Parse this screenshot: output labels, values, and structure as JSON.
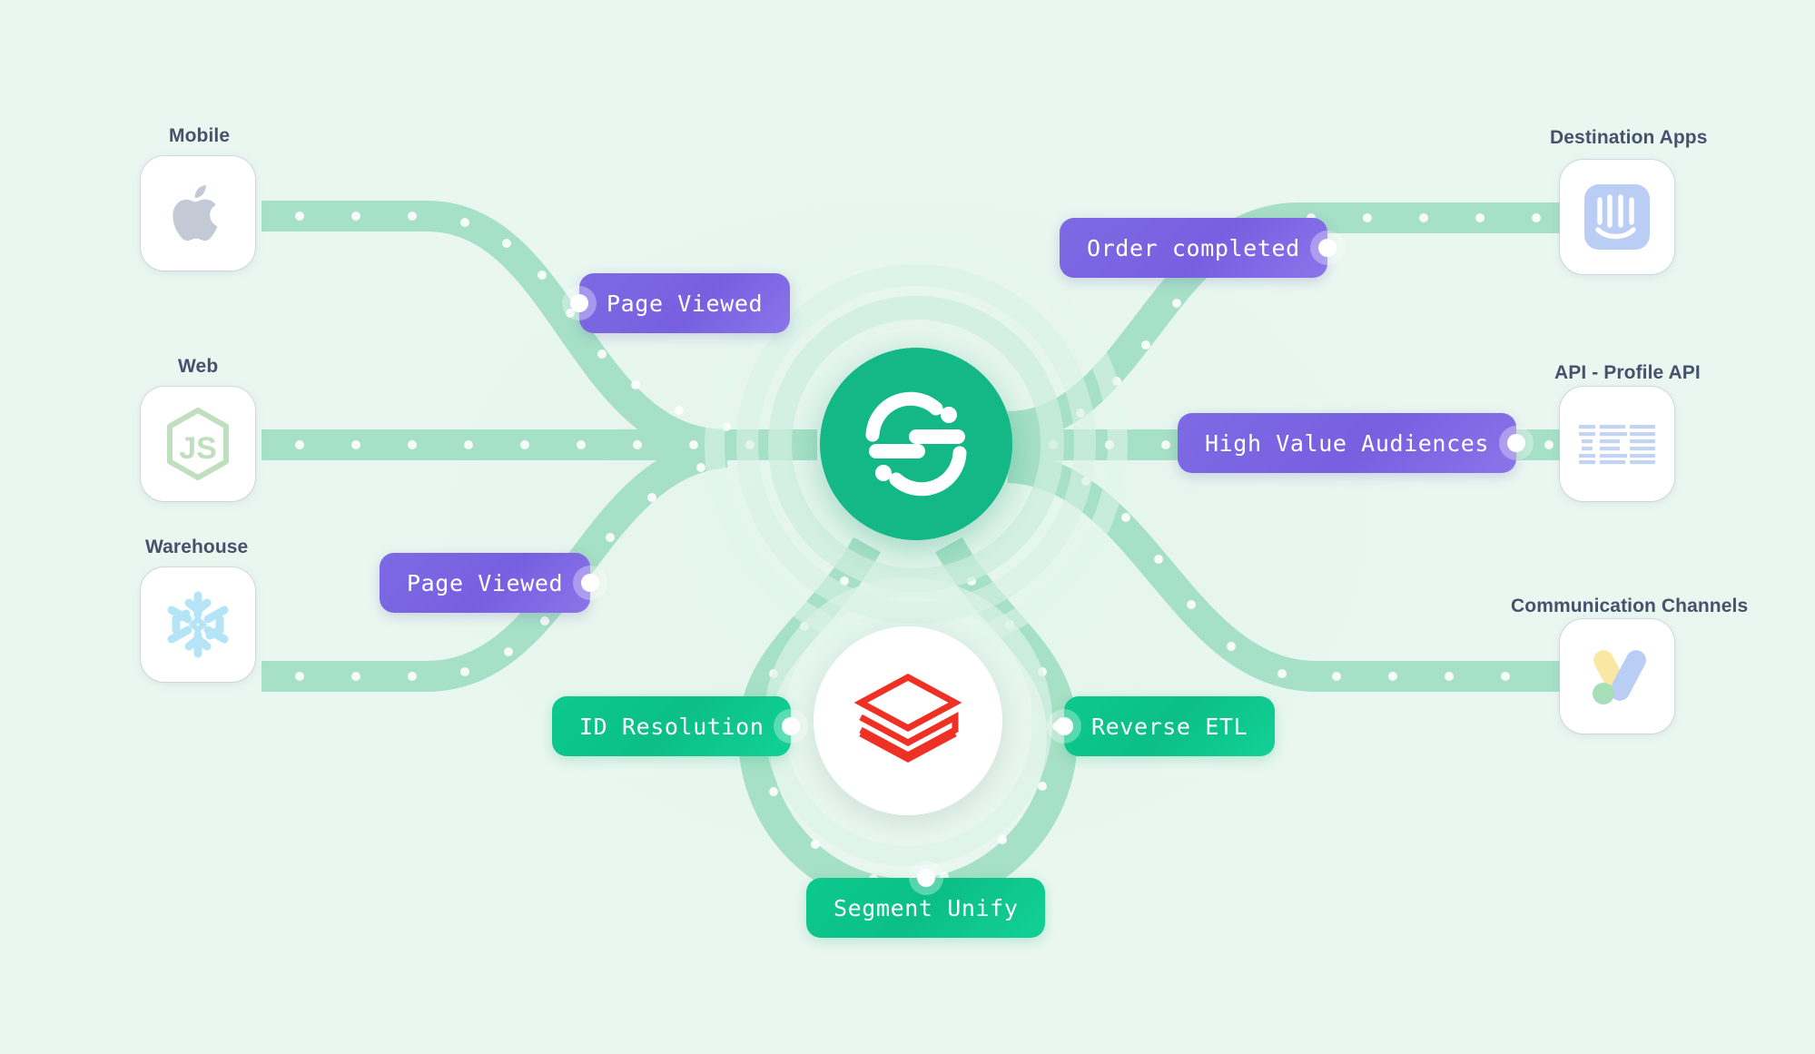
{
  "diagram": {
    "title": "Segment Customer Data Platform flow",
    "background_color": "#eaf7f1",
    "pipe_color": "#a6e0c6",
    "pipe_dot_color": "#ffffff"
  },
  "hub": {
    "center_logo": "segment-logo",
    "center_color": "#13b886",
    "lower_logo": "databricks-logo",
    "lower_logo_color": "#ee3124"
  },
  "sources": [
    {
      "label": "Mobile",
      "icon": "apple-logo",
      "icon_color": "#c3cad6"
    },
    {
      "label": "Web",
      "icon": "nodejs-logo",
      "icon_color": "#bfdfbf"
    },
    {
      "label": "Warehouse",
      "icon": "snowflake-logo",
      "icon_color": "#b4e4f6"
    }
  ],
  "destinations": [
    {
      "label": "Destination Apps",
      "icon": "intercom-logo",
      "icon_color": "#b9cdf5"
    },
    {
      "label": "API - Profile API",
      "icon": "ibm-logo",
      "icon_color": "#c3d3f2"
    },
    {
      "label": "Communication Channels",
      "icon": "google-ads-logo",
      "icon_color": "#a8c7f0"
    }
  ],
  "pills": {
    "page_viewed_top": {
      "label": "Page Viewed",
      "color": "#7760e0",
      "dot": "left"
    },
    "order_completed": {
      "label": "Order completed",
      "color": "#7760e0",
      "dot": "right"
    },
    "high_value_audiences": {
      "label": "High Value Audiences",
      "color": "#7760e0",
      "dot": "right"
    },
    "page_viewed_bottom": {
      "label": "Page Viewed",
      "color": "#7760e0",
      "dot": "right"
    },
    "id_resolution": {
      "label": "ID Resolution",
      "color": "#0cc98c",
      "dot": "right"
    },
    "reverse_etl": {
      "label": "Reverse ETL",
      "color": "#0cc98c",
      "dot": "left"
    },
    "segment_unify": {
      "label": "Segment Unify",
      "color": "#0cc98c",
      "dot": "top"
    }
  }
}
